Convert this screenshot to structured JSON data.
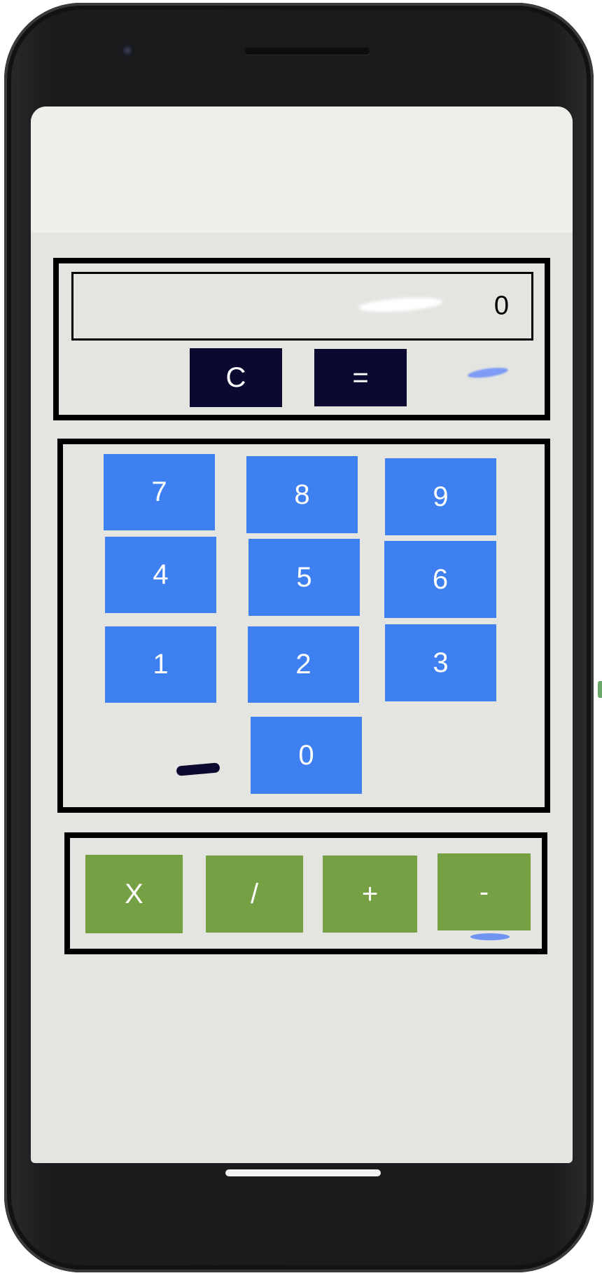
{
  "calculator": {
    "display": {
      "value": "0"
    },
    "controls": {
      "clear_label": "C",
      "equals_label": "="
    },
    "numpad": {
      "seven": "7",
      "eight": "8",
      "nine": "9",
      "four": "4",
      "five": "5",
      "six": "6",
      "one": "1",
      "two": "2",
      "three": "3",
      "zero": "0"
    },
    "operators": {
      "multiply": "X",
      "divide": "/",
      "add": "+",
      "subtract": "-"
    }
  },
  "colors": {
    "control_button": "#0c0930",
    "number_button": "#3f80f1",
    "operator_button": "#76a044",
    "screen_background": "#e4e5e1",
    "panel_border": "#000000"
  }
}
